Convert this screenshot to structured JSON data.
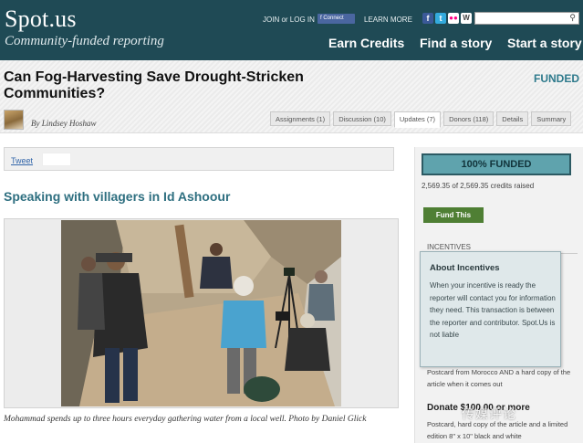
{
  "header": {
    "logo": "Spot.us",
    "tagline": "Community-funded reporting",
    "join_text": "JOIN or LOG IN",
    "connect_label": "f Connect",
    "learn_more": "LEARN MORE",
    "nav": [
      "Earn Credits",
      "Find a story",
      "Start a story"
    ],
    "search_placeholder": ""
  },
  "story": {
    "title": "Can Fog-Harvesting Save Drought-Stricken Communities?",
    "status": "FUNDED",
    "byline": "By Lindsey Hoshaw",
    "tabs": [
      {
        "label": "Assignments (1)",
        "active": false
      },
      {
        "label": "Discussion (10)",
        "active": false
      },
      {
        "label": "Updates (7)",
        "active": true
      },
      {
        "label": "Donors (118)",
        "active": false
      },
      {
        "label": "Details",
        "active": false
      },
      {
        "label": "Summary",
        "active": false
      }
    ]
  },
  "update": {
    "tweet_label": "Tweet",
    "title": "Speaking with villagers in Id Ashoour",
    "caption": "Mohammad spends up to three hours everyday gathering water from a local well. Photo by Daniel Glick"
  },
  "sidebar": {
    "percent_label": "100% FUNDED",
    "percent_value": 100,
    "raised_text": "2,569.35 of 2,569.35 credits raised",
    "fund_button": "Fund This",
    "incentives_label": "INCENTIVES",
    "tooltip_title": "About Incentives",
    "tooltip_text": "When your incentive is ready the reporter will contact you for information they need. This transaction is between the reporter and contributor. Spot.Us is not liable",
    "incentive1_text": "Postcard from Morocco AND a hard copy of the article when it comes out",
    "incentive2_title": "Donate $100.00 or more",
    "incentive2_text": "Postcard, hard copy of the article and a limited edition 8\" x 10\" black and white"
  },
  "overlay": {
    "watermark": "传媒评论"
  },
  "colors": {
    "header_bg": "#1f4a55",
    "accent": "#2e6f80",
    "funded_bar": "#5fa3ad",
    "fund_button": "#4f7f34"
  },
  "icons": [
    "facebook-icon",
    "twitter-icon",
    "flickr-icon",
    "wordpress-icon",
    "search-icon"
  ]
}
